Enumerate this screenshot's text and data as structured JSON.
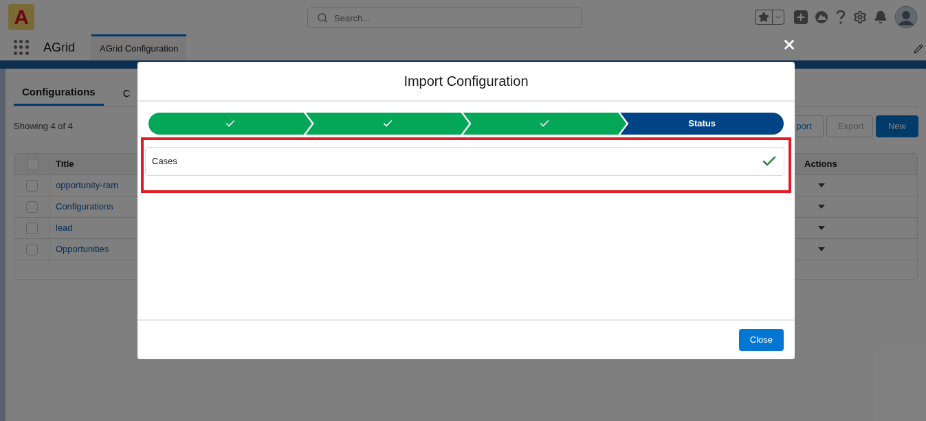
{
  "header": {
    "logo_text": "A",
    "search": {
      "placeholder": "Search..."
    }
  },
  "nav": {
    "app_name": "AGrid",
    "tabs": [
      {
        "label": "AGrid Configuration",
        "selected": true
      }
    ]
  },
  "page": {
    "tabs": [
      {
        "label": "Configurations",
        "selected": true
      },
      {
        "label": "C",
        "selected": false
      }
    ],
    "record_count": "Showing 4 of 4",
    "buttons": [
      {
        "label": "port",
        "kind": "default",
        "disabled": false
      },
      {
        "label": "Export",
        "kind": "default",
        "disabled": true
      },
      {
        "label": "New",
        "kind": "primary",
        "disabled": false
      }
    ],
    "table": {
      "columns": [
        "Title",
        "Actions"
      ],
      "select_all_checked": false,
      "rows": [
        {
          "title": "opportunity-ram",
          "checked": false
        },
        {
          "title": "Configurations",
          "checked": false
        },
        {
          "title": "lead",
          "checked": false
        },
        {
          "title": "Opportunities",
          "checked": false
        }
      ]
    }
  },
  "modal": {
    "title": "Import Configuration",
    "steps": [
      {
        "kind": "done"
      },
      {
        "kind": "done"
      },
      {
        "kind": "done"
      },
      {
        "kind": "current",
        "label": "Status"
      }
    ],
    "results": [
      {
        "name": "Cases",
        "success": true
      }
    ],
    "close_button": "Close"
  }
}
